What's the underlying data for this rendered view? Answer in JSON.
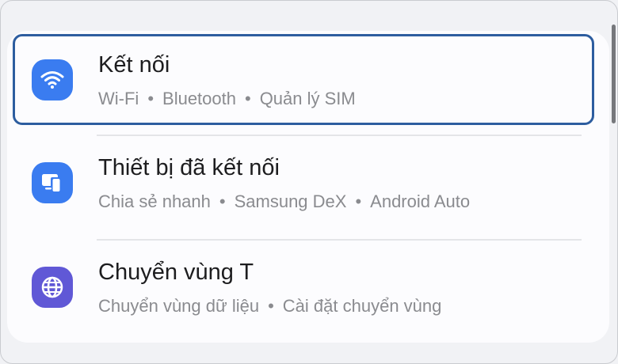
{
  "settings": {
    "items": [
      {
        "title": "Kết nối",
        "subtitle": [
          "Wi-Fi",
          "Bluetooth",
          "Quản lý SIM"
        ],
        "icon": "wifi-icon",
        "icon_color": "#3a7cf0",
        "selected": true
      },
      {
        "title": "Thiết bị đã kết nối",
        "subtitle": [
          "Chia sẻ nhanh",
          "Samsung DeX",
          "Android Auto"
        ],
        "icon": "connected-devices-icon",
        "icon_color": "#3a7cf0",
        "selected": false
      },
      {
        "title": "Chuyển vùng T",
        "subtitle": [
          "Chuyển vùng dữ liệu",
          "Cài đặt chuyển vùng"
        ],
        "icon": "globe-icon",
        "icon_color": "#6058d6",
        "selected": false
      }
    ],
    "separator": "•",
    "selection_border_color": "#2d5d9f"
  }
}
